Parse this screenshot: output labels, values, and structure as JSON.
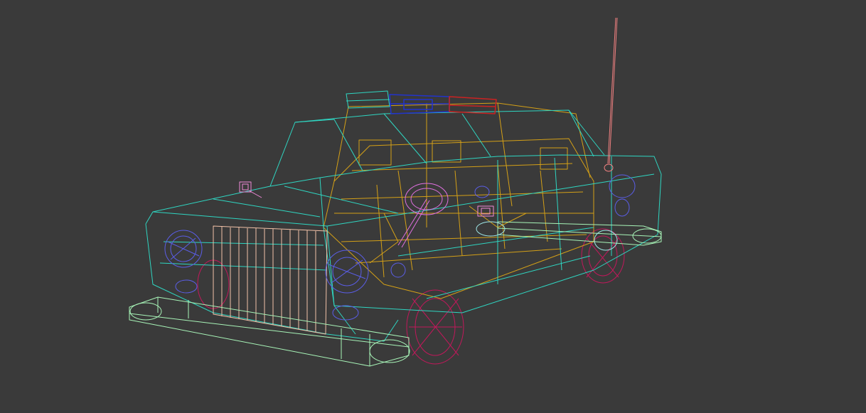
{
  "viewport": {
    "background": "#3a3a3a",
    "render_mode": "wireframe"
  },
  "model": {
    "subject": "police-car",
    "parts": [
      {
        "name": "body-shell",
        "color": "#2fd6c2"
      },
      {
        "name": "interior-frame",
        "color": "#d4a017"
      },
      {
        "name": "front-grille",
        "color": "#f2c2a8"
      },
      {
        "name": "bumpers",
        "color": "#a8f5b8"
      },
      {
        "name": "headlights",
        "color": "#5b5ee8"
      },
      {
        "name": "wheels",
        "color": "#c2185b"
      },
      {
        "name": "light-bar-blue",
        "color": "#2233cc"
      },
      {
        "name": "light-bar-red",
        "color": "#cc2222"
      },
      {
        "name": "antenna",
        "color": "#f08080"
      },
      {
        "name": "steering-wheel",
        "color": "#e070e0"
      },
      {
        "name": "side-mirror",
        "color": "#f08ad8"
      }
    ]
  }
}
